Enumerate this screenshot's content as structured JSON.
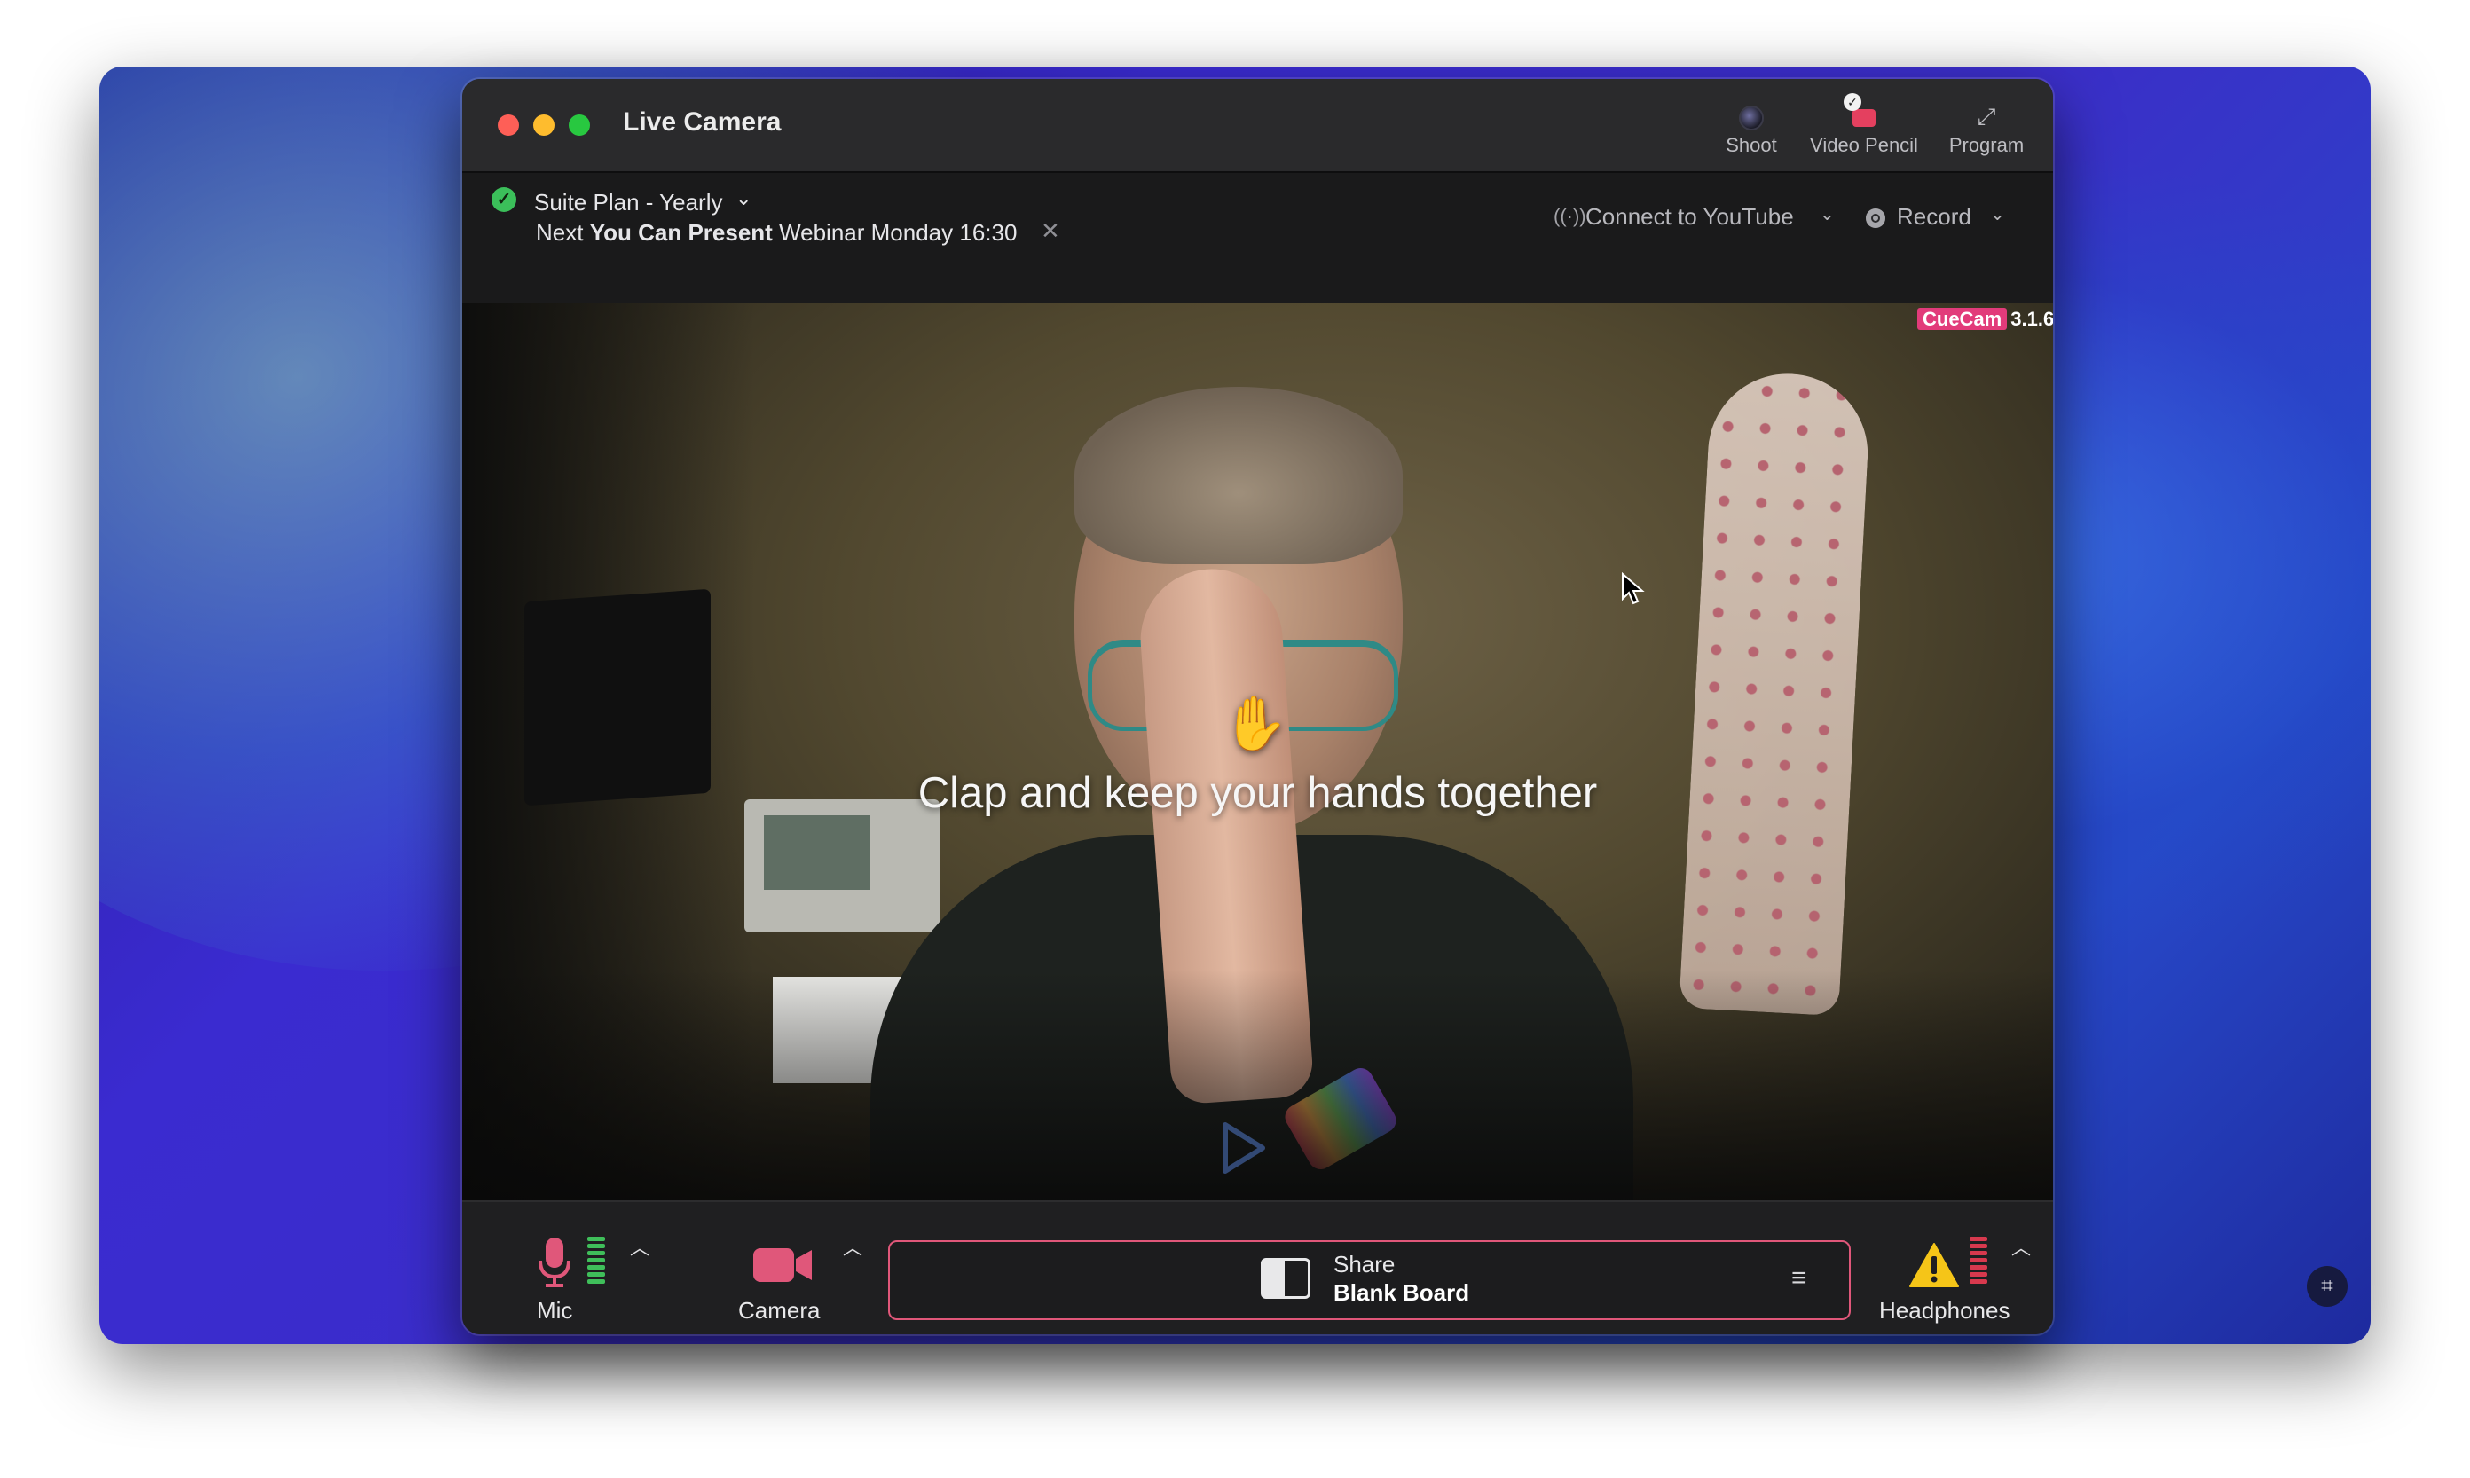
{
  "window": {
    "title": "Live Camera",
    "toolbar": [
      {
        "label": "Shoot",
        "icon": "camera-lens-icon"
      },
      {
        "label": "Video Pencil",
        "icon": "video-pencil-icon",
        "badge": "✓"
      },
      {
        "label": "Program",
        "icon": "expand-icon"
      }
    ]
  },
  "infobar": {
    "plan_label": "Suite Plan - Yearly",
    "next_prefix": "Next",
    "next_bold": "You Can Present",
    "next_suffix": "Webinar Monday 16:30",
    "youtube_label": "Connect to YouTube",
    "record_label": "Record"
  },
  "video": {
    "overlay_text": "Clap and keep your hands together",
    "brand_name": "CueCam",
    "brand_version": "3.1.6"
  },
  "controls": {
    "mic_label": "Mic",
    "camera_label": "Camera",
    "share_title": "Share",
    "share_subtitle": "Blank Board",
    "headphones_label": "Headphones"
  },
  "colors": {
    "accent": "#e23b7a",
    "success": "#3bbf5a",
    "warning": "#f5c518",
    "meter_green": "#3fbf5a",
    "meter_red": "#d8394e"
  }
}
